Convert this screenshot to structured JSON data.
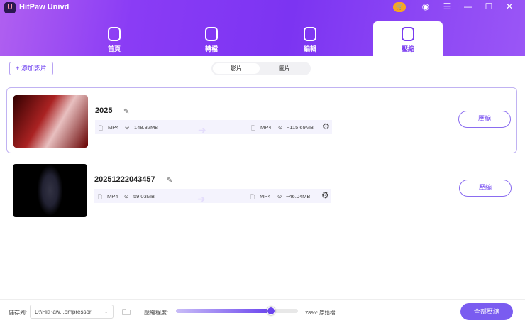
{
  "app": {
    "title": "HitPaw Univd",
    "logo": "U"
  },
  "tabs": [
    {
      "label": "首頁"
    },
    {
      "label": "轉檔"
    },
    {
      "label": "編輯"
    },
    {
      "label": "壓縮"
    }
  ],
  "toolbar": {
    "add_label": "+ 添加影片",
    "seg": [
      "影片",
      "圖片"
    ]
  },
  "files": [
    {
      "name": "2025",
      "in_fmt": "MP4",
      "in_size": "148.32MB",
      "out_fmt": "MP4",
      "out_size": "~115.69MB",
      "button": "壓縮"
    },
    {
      "name": "20251222043457",
      "in_fmt": "MP4",
      "in_size": "59.03MB",
      "out_fmt": "MP4",
      "out_size": "~46.04MB",
      "button": "壓縮"
    }
  ],
  "footer": {
    "save_label": "儲存到:",
    "path": "D:\\HitPaw...ompressor",
    "level_label": "壓縮程度:",
    "level_value": 78,
    "level_text": "78%* 原始檔",
    "compress_all": "全部壓縮"
  },
  "colors": {
    "accent": "#7a4cf0"
  }
}
